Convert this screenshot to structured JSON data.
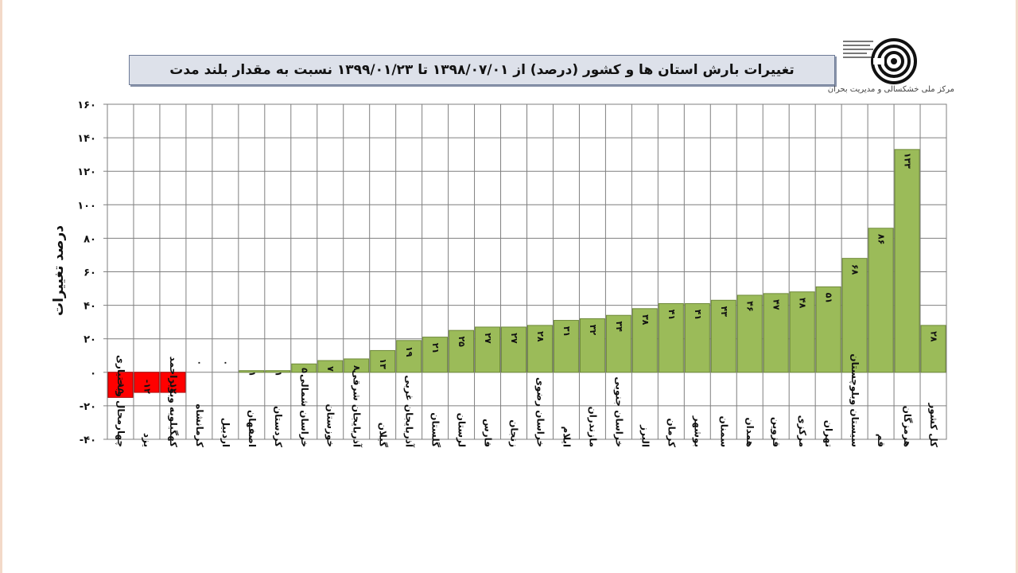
{
  "title": "تغییرات بارش استان ها و کشور (درصد) از ۱۳۹۸/۰۷/۰۱ تا ۱۳۹۹/۰۱/۲۳ نسبت به مقدار بلند مدت",
  "logo": {
    "caption": "مرکز ملی خشکسالی و مدیریت بحران"
  },
  "colors": {
    "positive": "#9bbb59",
    "negative": "#ff0000",
    "grid": "#7f7f7f"
  },
  "chart_data": {
    "type": "bar",
    "ylabel": "درصد تغییرات",
    "xlabel": "",
    "ylim": [
      -40,
      160
    ],
    "yticks": [
      -40,
      -20,
      0,
      20,
      40,
      60,
      80,
      100,
      120,
      140,
      160
    ],
    "ytick_labels": [
      "-۴۰",
      "-۲۰",
      "۰",
      "۲۰",
      "۴۰",
      "۶۰",
      "۸۰",
      "۱۰۰",
      "۱۲۰",
      "۱۴۰",
      "۱۶۰"
    ],
    "grid": true,
    "categories": [
      "چهارمحال وبختیاری",
      "یزد",
      "کهگیلویه وبویراحمد",
      "کرمانشاه",
      "اردبیل",
      "اصفهان",
      "کردستان",
      "خراسان شمالی",
      "خوزستان",
      "آذربایجان شرقی",
      "گیلان",
      "آذربایجان غربی",
      "گلستان",
      "لرستان",
      "فارس",
      "زنجان",
      "خراسان رضوی",
      "ایلام",
      "مازندران",
      "خراسان جنوبی",
      "البرز",
      "کرمان",
      "بوشهر",
      "سمنان",
      "همدان",
      "قزوین",
      "مرکزی",
      "تهران",
      "سیستان وبلوچستان",
      "قم",
      "هرمزگان",
      "کل کشور"
    ],
    "values": [
      -15,
      -12,
      -12,
      0,
      0,
      1,
      1,
      5,
      7,
      8,
      13,
      19,
      21,
      25,
      27,
      27,
      28,
      31,
      32,
      34,
      38,
      41,
      41,
      43,
      46,
      47,
      48,
      51,
      68,
      86,
      133,
      28
    ],
    "data_labels": [
      "-۱۵",
      "-۱۲",
      "-۱۲",
      "۰",
      "۰",
      "۱",
      "۱",
      "۵",
      "۷",
      "۸",
      "۱۳",
      "۱۹",
      "۲۱",
      "۲۵",
      "۲۷",
      "۲۷",
      "۲۸",
      "۳۱",
      "۳۲",
      "۳۴",
      "۳۸",
      "۴۱",
      "۴۱",
      "۴۳",
      "۴۶",
      "۴۷",
      "۴۸",
      "۵۱",
      "۶۸",
      "۸۶",
      "۱۳۳",
      "۲۸"
    ]
  }
}
